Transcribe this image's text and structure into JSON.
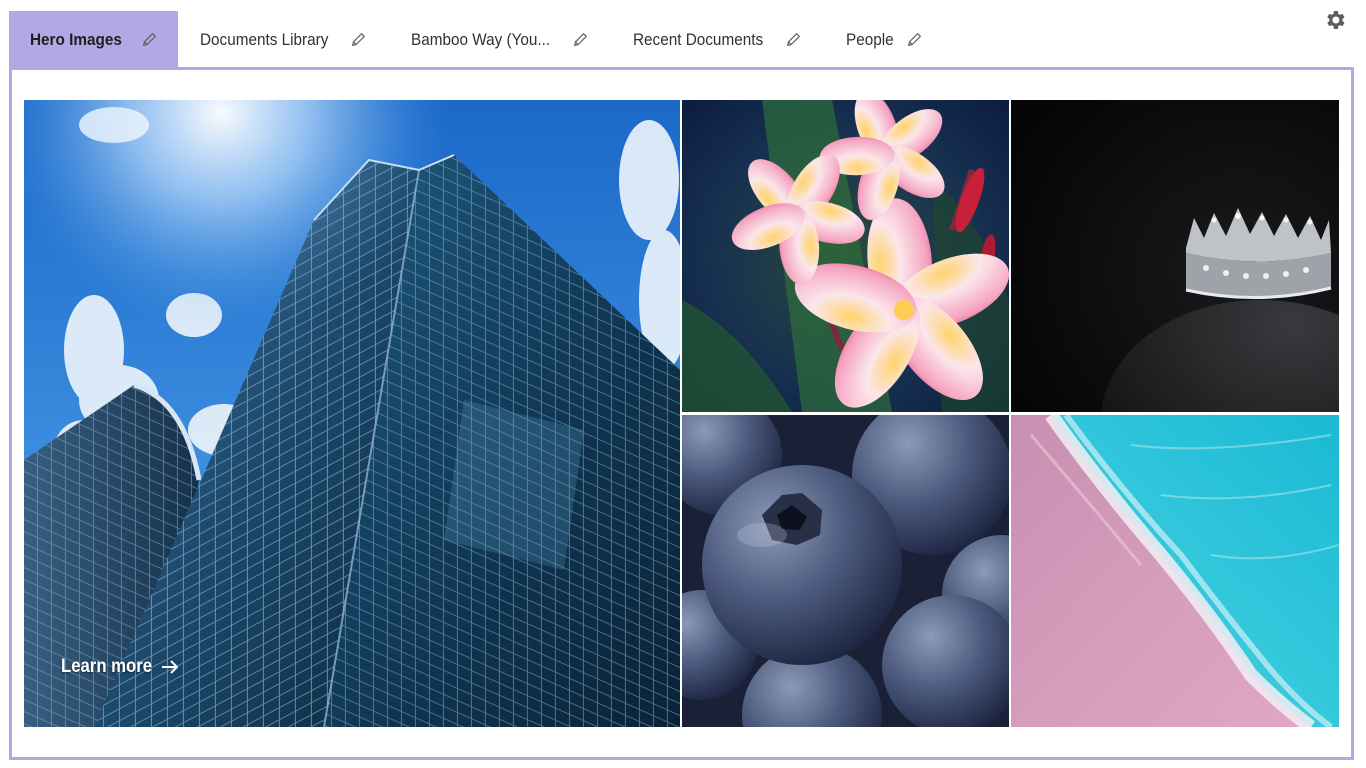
{
  "tabs": [
    {
      "label": "Hero Images",
      "active": true
    },
    {
      "label": "Documents Library",
      "active": false
    },
    {
      "label": "Bamboo Way (You...",
      "active": false
    },
    {
      "label": "Recent Documents",
      "active": false
    },
    {
      "label": "People",
      "active": false
    }
  ],
  "hero": {
    "link_label": "Learn more"
  },
  "tiles": [
    {
      "subject": "skyscraper"
    },
    {
      "subject": "plumeria-flowers"
    },
    {
      "subject": "crown"
    },
    {
      "subject": "blueberries"
    },
    {
      "subject": "beach-waves"
    }
  ],
  "icons": {
    "edit": "pencil-icon",
    "settings": "gear-icon",
    "link": "arrow-right-icon"
  },
  "colors": {
    "accent": "#b4a7e5",
    "text": "#323130"
  }
}
